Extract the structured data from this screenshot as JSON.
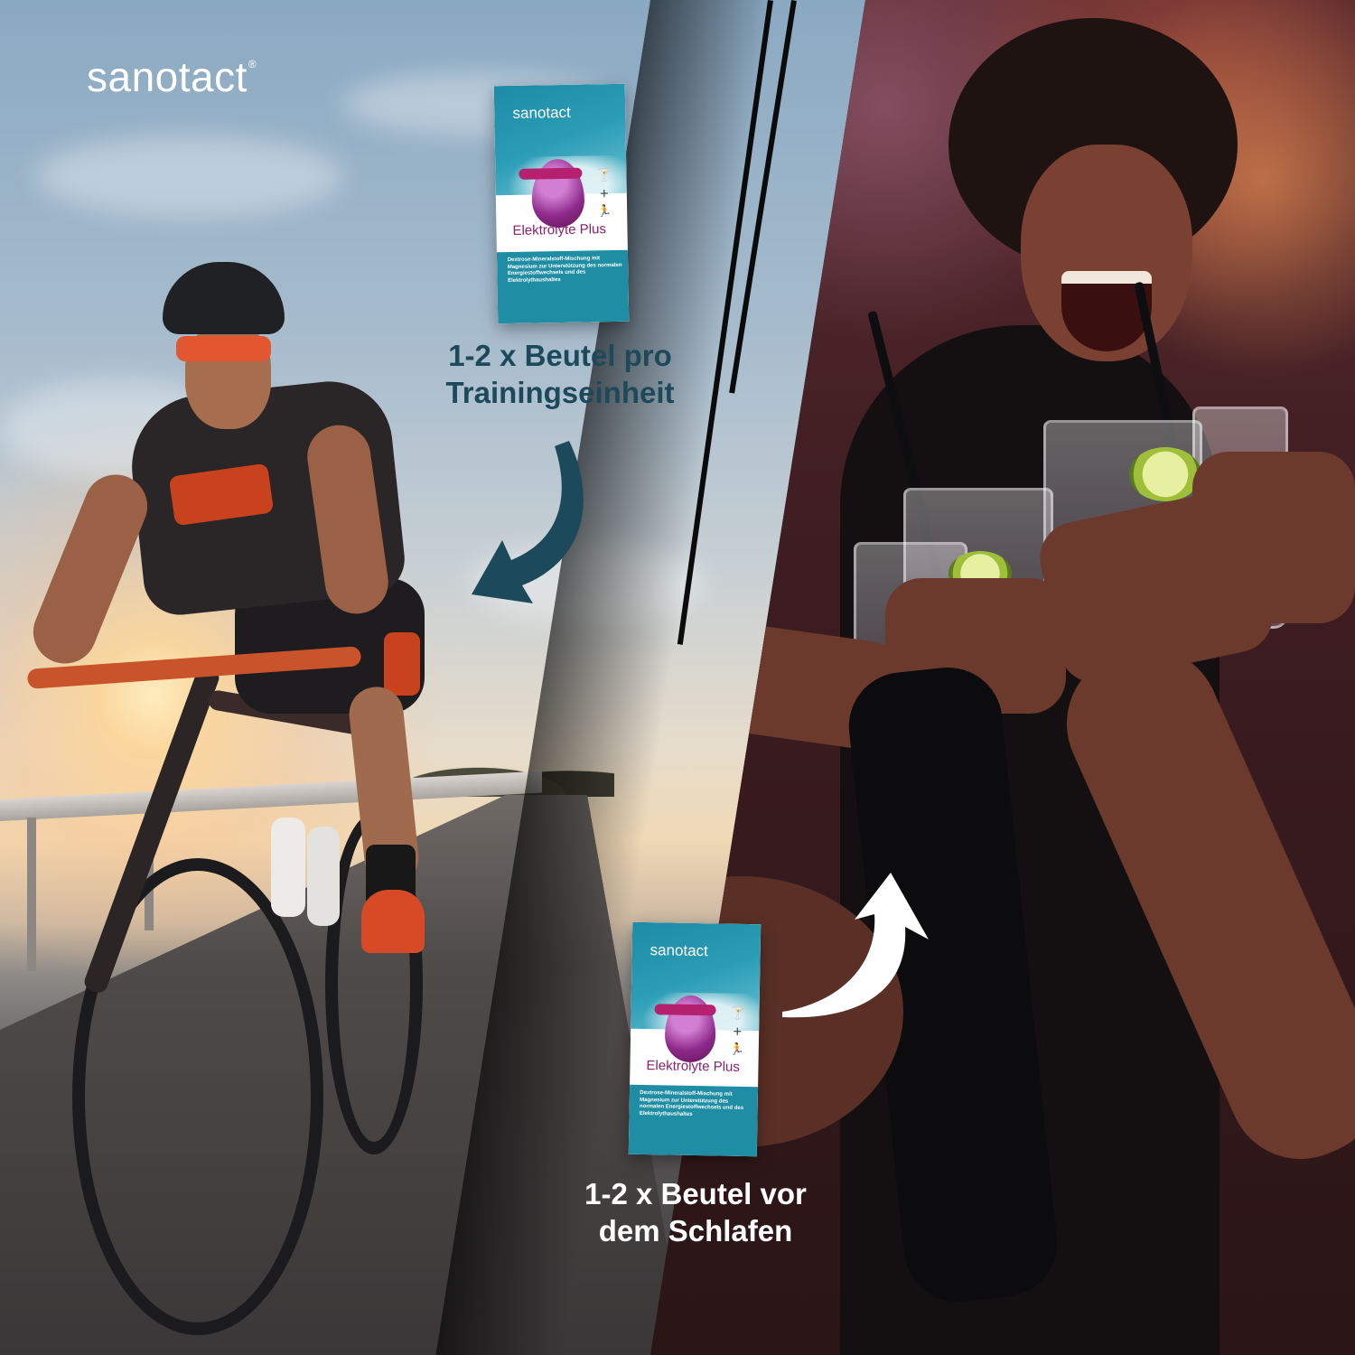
{
  "brand": {
    "name": "sanotact",
    "mark": "®"
  },
  "packets": [
    {
      "brand": "sanotact",
      "product_name": "Elektrolyte Plus",
      "description": "Dextrose-Mineralstoff-Mischung mit Magnesium zur Unterstützung des normalen Energiestoffwechsels und des Elektrolythaushaltes",
      "icon_names": [
        "cocktail-icon",
        "plus-icon",
        "runner-icon"
      ]
    },
    {
      "brand": "sanotact",
      "product_name": "Elektrolyte Plus",
      "description": "Dextrose-Mineralstoff-Mischung mit Magnesium zur Unterstützung des normalen Energiestoffwechsels und des Elektrolythaushaltes",
      "icon_names": [
        "cocktail-icon",
        "plus-icon",
        "runner-icon"
      ]
    }
  ],
  "captions": {
    "training": {
      "line1": "1-2 x Beutel pro",
      "line2": "Trainingseinheit"
    },
    "sleep": {
      "line1": "1-2 x Beutel vor",
      "line2": "dem Schlafen"
    }
  },
  "colors": {
    "caption_dark": "#1d4a5a",
    "arrow_dark": "#1d4a5a",
    "arrow_light": "#ffffff",
    "packet_teal": "#1f8ea4",
    "packet_magenta": "#8a1f6e"
  }
}
